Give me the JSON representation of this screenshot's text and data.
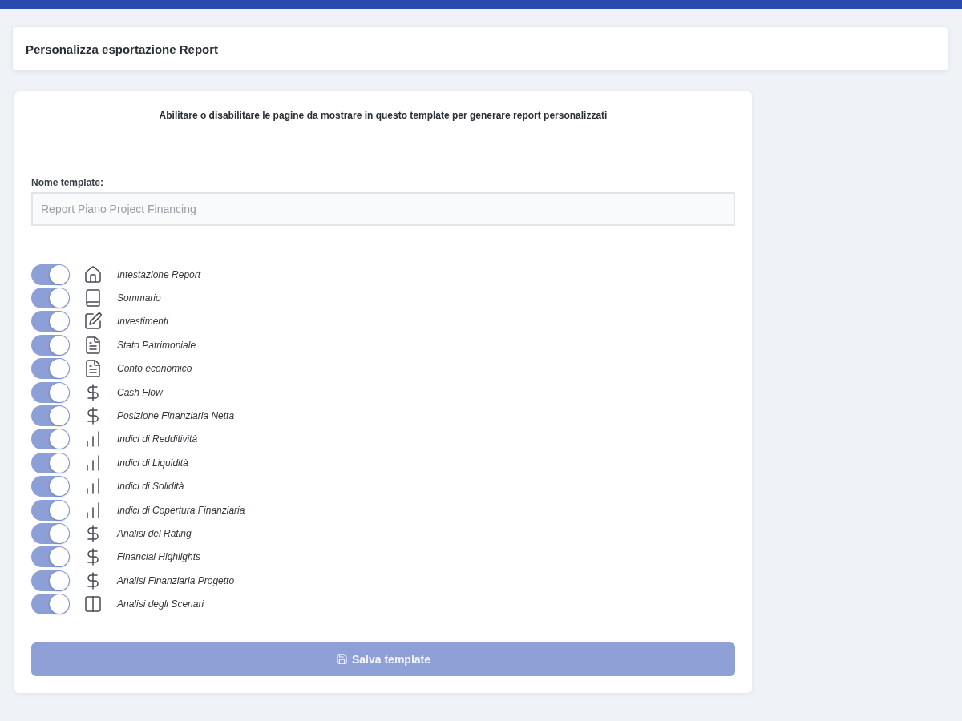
{
  "header": {
    "title": "Personalizza esportazione Report"
  },
  "form": {
    "intro": "Abilitare o disabilitare le pagine da mostrare in questo template per generare report personalizzati",
    "template_name": {
      "label": "Nome template:",
      "placeholder": "Report Piano Project Financing"
    },
    "pages": [
      {
        "label": "Intestazione Report",
        "on": true
      },
      {
        "label": "Sommario",
        "on": true
      },
      {
        "label": "Investimenti",
        "on": true
      },
      {
        "label": "Stato Patrimoniale",
        "on": true
      },
      {
        "label": "Conto economico",
        "on": true
      },
      {
        "label": "Cash Flow",
        "on": true
      },
      {
        "label": "Posizione Finanziaria Netta",
        "on": true
      },
      {
        "label": "Indici di Redditività",
        "on": true
      },
      {
        "label": "Indici di Liquidità",
        "on": true
      },
      {
        "label": "Indici di Solidità",
        "on": true
      },
      {
        "label": "Indici di Copertura Finanziaria",
        "on": true
      },
      {
        "label": "Analisi del Rating",
        "on": true
      },
      {
        "label": "Financial Highlights",
        "on": true
      },
      {
        "label": "Analisi Finanziaria Progetto",
        "on": true
      },
      {
        "label": "Analisi degli Scenari",
        "on": true
      }
    ],
    "save_button": {
      "label": "Salva template",
      "disabled": true
    }
  }
}
